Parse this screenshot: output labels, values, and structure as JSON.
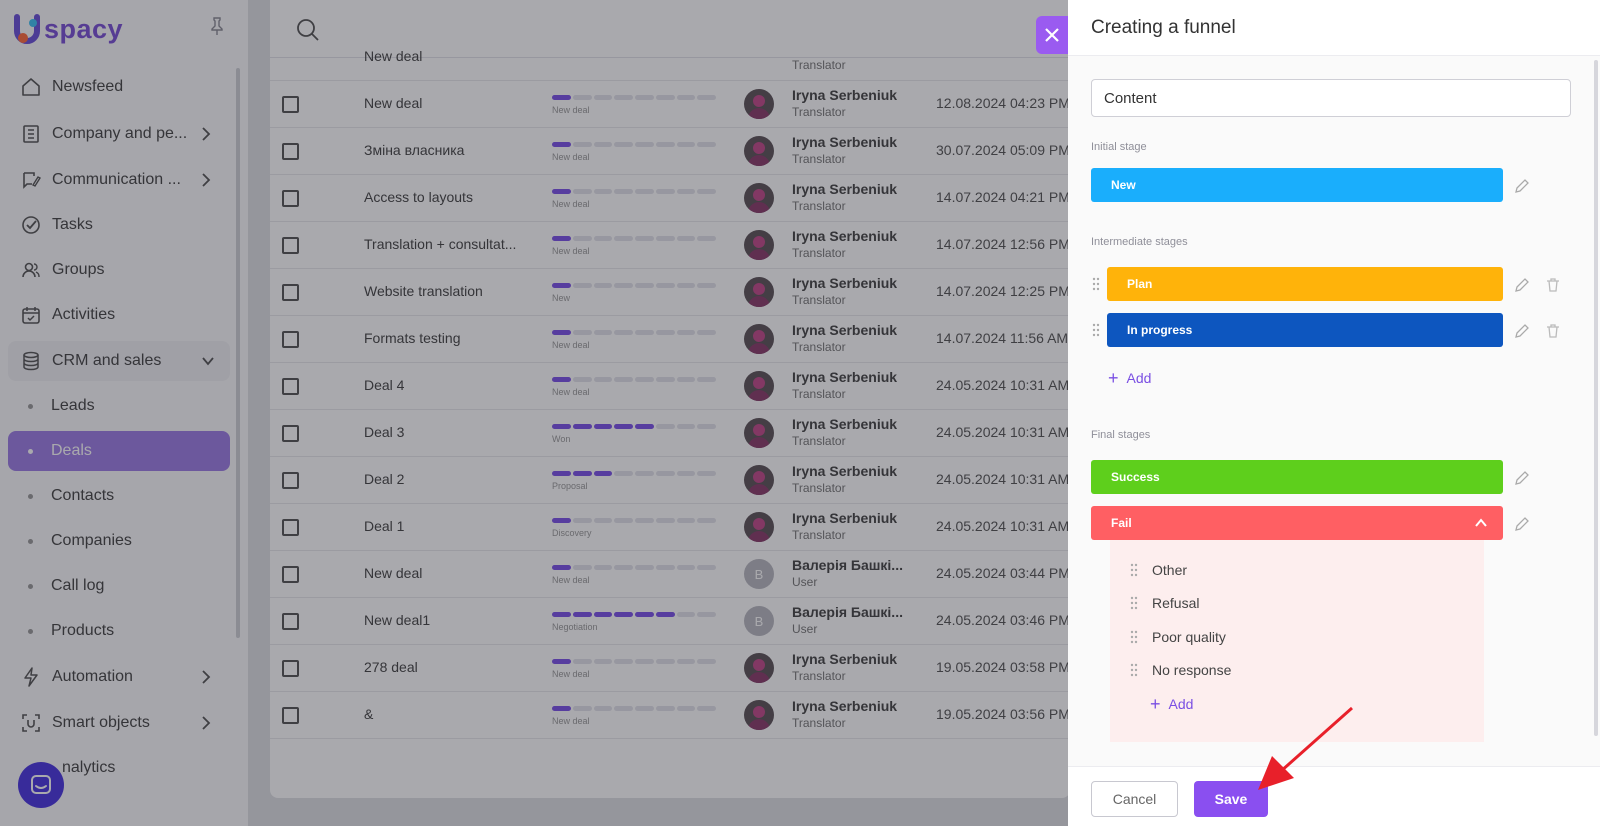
{
  "app": {
    "logo_text": "spacy"
  },
  "sidebar": {
    "items": [
      {
        "label": "Newsfeed",
        "icon": "home-icon"
      },
      {
        "label": "Company and pe...",
        "icon": "building-icon",
        "has_children": true
      },
      {
        "label": "Communication ...",
        "icon": "chat-edit-icon",
        "has_children": true
      },
      {
        "label": "Tasks",
        "icon": "check-circle-icon"
      },
      {
        "label": "Groups",
        "icon": "users-icon"
      },
      {
        "label": "Activities",
        "icon": "calendar-icon"
      },
      {
        "label": "CRM and sales",
        "icon": "database-icon",
        "expanded": true
      },
      {
        "label": "Automation",
        "icon": "lightning-icon",
        "has_children": true
      },
      {
        "label": "Smart objects",
        "icon": "smart-icon",
        "has_children": true
      },
      {
        "label": "nalytics",
        "icon": "chart-icon"
      }
    ],
    "crm_sub_items": [
      "Leads",
      "Deals",
      "Contacts",
      "Companies",
      "Call log",
      "Products"
    ],
    "active_sub_item": "Deals"
  },
  "deals": {
    "rows": [
      {
        "name": "New deal",
        "stage": "New deal",
        "progress": 1,
        "user": "Iryna Serbeniuk",
        "role": "Translator",
        "date": "12.08.2024 04:23 PM"
      },
      {
        "name": "Зміна власника",
        "stage": "New deal",
        "progress": 1,
        "user": "Iryna Serbeniuk",
        "role": "Translator",
        "date": "30.07.2024 05:09 PM"
      },
      {
        "name": "Access to layouts",
        "stage": "New deal",
        "progress": 1,
        "user": "Iryna Serbeniuk",
        "role": "Translator",
        "date": "14.07.2024 04:21 PM"
      },
      {
        "name": "Translation + consultat...",
        "stage": "New deal",
        "progress": 1,
        "user": "Iryna Serbeniuk",
        "role": "Translator",
        "date": "14.07.2024 12:56 PM"
      },
      {
        "name": "Website translation",
        "stage": "New",
        "progress": 1,
        "user": "Iryna Serbeniuk",
        "role": "Translator",
        "date": "14.07.2024 12:25 PM"
      },
      {
        "name": "Formats testing",
        "stage": "New deal",
        "progress": 1,
        "user": "Iryna Serbeniuk",
        "role": "Translator",
        "date": "14.07.2024 11:56 AM"
      },
      {
        "name": "Deal 4",
        "stage": "New deal",
        "progress": 1,
        "user": "Iryna Serbeniuk",
        "role": "Translator",
        "date": "24.05.2024 10:31 AM"
      },
      {
        "name": "Deal 3",
        "stage": "Won",
        "progress": 5,
        "user": "Iryna Serbeniuk",
        "role": "Translator",
        "date": "24.05.2024 10:31 AM"
      },
      {
        "name": "Deal 2",
        "stage": "Proposal",
        "progress": 3,
        "user": "Iryna Serbeniuk",
        "role": "Translator",
        "date": "24.05.2024 10:31 AM"
      },
      {
        "name": "Deal 1",
        "stage": "Discovery",
        "progress": 1,
        "user": "Iryna Serbeniuk",
        "role": "Translator",
        "date": "24.05.2024 10:31 AM"
      },
      {
        "name": "New deal",
        "stage": "New deal",
        "progress": 1,
        "user": "Валерія Башкі...",
        "role": "User",
        "date": "24.05.2024 03:44 PM",
        "avatar_letter": "В"
      },
      {
        "name": "New deal1",
        "stage": "Negotiation",
        "progress": 6,
        "user": "Валерія Башкі...",
        "role": "User",
        "date": "24.05.2024 03:46 PM",
        "avatar_letter": "В"
      },
      {
        "name": "278 deal",
        "stage": "New deal",
        "progress": 1,
        "user": "Iryna Serbeniuk",
        "role": "Translator",
        "date": "19.05.2024 03:58 PM"
      },
      {
        "name": "&",
        "stage": "New deal",
        "progress": 1,
        "user": "Iryna Serbeniuk",
        "role": "Translator",
        "date": "19.05.2024 03:56 PM"
      }
    ],
    "header_row_partial": {
      "name": "New deal",
      "role": "Translator"
    }
  },
  "drawer": {
    "title": "Creating a funnel",
    "name_value": "Content",
    "initial_label": "Initial stage",
    "intermediate_label": "Intermediate stages",
    "final_label": "Final stages",
    "initial_stage": {
      "label": "New",
      "color": "#1aaefc"
    },
    "intermediate_stages": [
      {
        "label": "Plan",
        "color": "#ffb30a"
      },
      {
        "label": "In progress",
        "color": "#0d56bf"
      }
    ],
    "add_label": "Add",
    "final_stages": [
      {
        "label": "Success",
        "color": "#5ecf1c"
      },
      {
        "label": "Fail",
        "color": "#ff5f63"
      }
    ],
    "fail_reasons": [
      "Other",
      "Refusal",
      "Poor quality",
      "No response"
    ],
    "cancel_label": "Cancel",
    "save_label": "Save"
  },
  "colors": {
    "accent": "#8a4ff0",
    "arrow": "#e8202a"
  }
}
